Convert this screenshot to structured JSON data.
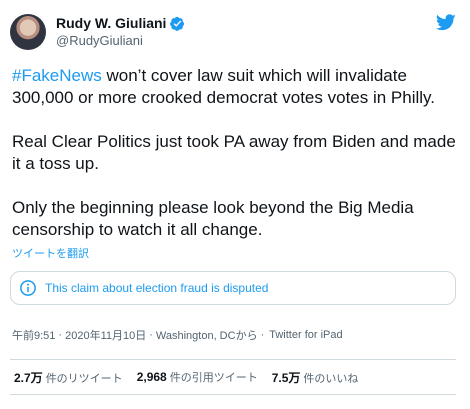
{
  "colors": {
    "accent": "#1d9bf0",
    "text": "#0f1419",
    "muted": "#536471",
    "border": "#cfd9de"
  },
  "author": {
    "display_name": "Rudy W. Giuliani",
    "handle": "@RudyGiuliani",
    "verified_icon": "verified-badge-icon",
    "avatar": "profile-photo"
  },
  "tweet": {
    "hashtag": "#FakeNews",
    "para1_rest": " won’t cover law suit which will invalidate 300,000 or more crooked democrat votes votes in Philly.",
    "para2": "Real Clear Politics just took PA away from Biden and made it a toss up.",
    "para3": "Only the beginning please look beyond the Big Media censorship to watch it all change."
  },
  "translate_link": "ツイートを翻訳",
  "notice": {
    "icon": "info-circle-icon",
    "text": "This claim about election fraud is disputed"
  },
  "meta": {
    "time": "午前9:51",
    "date": "2020年11月10日",
    "location": "Washington, DCから",
    "app": "Twitter for iPad",
    "separator": "·"
  },
  "stats": {
    "retweets_count": "2.7万",
    "retweets_label": "件のリツイート",
    "quotes_count": "2,968",
    "quotes_label": "件の引用ツイート",
    "likes_count": "7.5万",
    "likes_label": "件のいいね"
  },
  "logo": "twitter-bird-icon"
}
